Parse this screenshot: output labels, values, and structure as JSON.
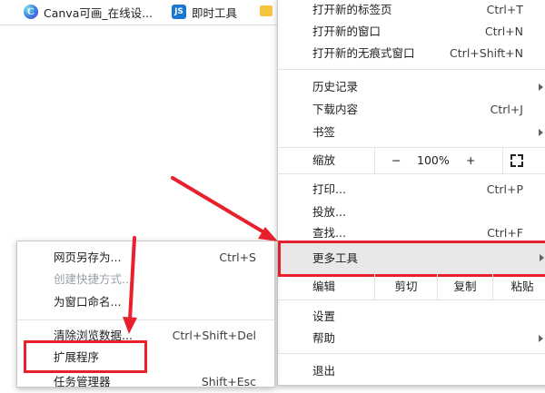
{
  "bookmarks": [
    {
      "label": "Canva可画_在线设...",
      "icon": "canva-logo-icon",
      "icon_glyph": "C"
    },
    {
      "label": "即时工具",
      "icon": "jishi-logo-icon",
      "icon_glyph": "JS"
    },
    {
      "label": "",
      "icon": "folder-icon"
    }
  ],
  "main_menu": {
    "new_tab": {
      "label": "打开新的标签页",
      "shortcut": "Ctrl+T"
    },
    "new_window": {
      "label": "打开新的窗口",
      "shortcut": "Ctrl+N"
    },
    "new_incognito": {
      "label": "打开新的无痕式窗口",
      "shortcut": "Ctrl+Shift+N"
    },
    "history": {
      "label": "历史记录"
    },
    "downloads": {
      "label": "下载内容",
      "shortcut": "Ctrl+J"
    },
    "bookmarks": {
      "label": "书签"
    },
    "zoom": {
      "label": "缩放",
      "minus": "−",
      "value": "100%",
      "plus": "+"
    },
    "print": {
      "label": "打印...",
      "shortcut": "Ctrl+P"
    },
    "cast": {
      "label": "投放..."
    },
    "find": {
      "label": "查找...",
      "shortcut": "Ctrl+F"
    },
    "more_tools": {
      "label": "更多工具"
    },
    "edit": {
      "label": "编辑",
      "cut": "剪切",
      "copy": "复制",
      "paste": "粘贴"
    },
    "settings": {
      "label": "设置"
    },
    "help": {
      "label": "帮助"
    },
    "exit": {
      "label": "退出"
    }
  },
  "sub_menu": {
    "save_page": {
      "label": "网页另存为...",
      "shortcut": "Ctrl+S"
    },
    "create_shortcut": {
      "label": "创建快捷方式..."
    },
    "name_window": {
      "label": "为窗口命名..."
    },
    "clear_data": {
      "label": "清除浏览数据...",
      "shortcut": "Ctrl+Shift+Del"
    },
    "extensions": {
      "label": "扩展程序"
    },
    "task_manager": {
      "label": "任务管理器",
      "shortcut": "Shift+Esc"
    }
  },
  "colors": {
    "annotation": "#e8202c",
    "hover_bg": "#e8e8e8"
  }
}
